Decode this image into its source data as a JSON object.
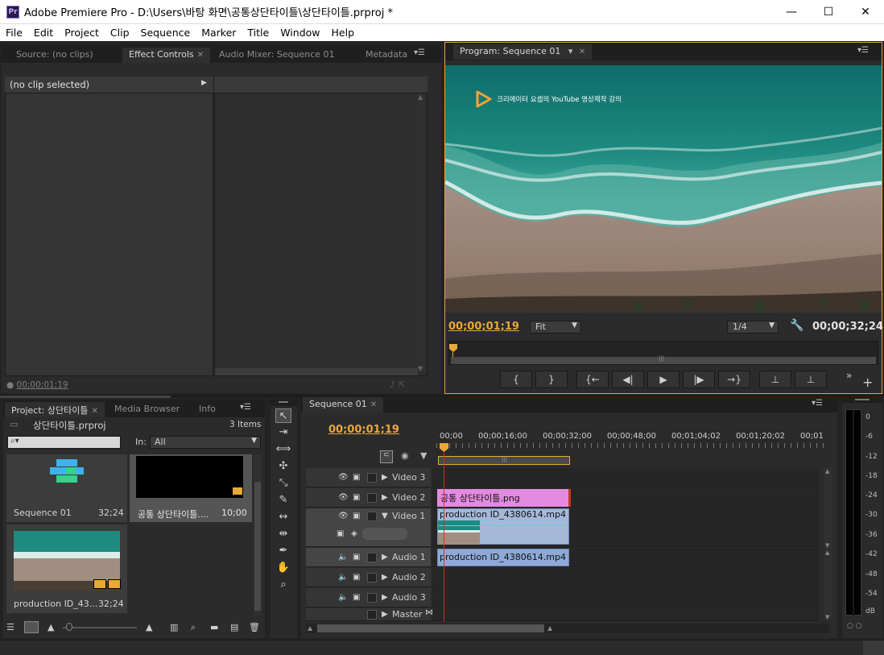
{
  "window": {
    "title": "Adobe Premiere Pro - D:\\Users\\바탕 화면\\공통상단타이틀\\상단타이틀.prproj *",
    "logo": "Pr",
    "minimize": "—",
    "maximize": "☐",
    "close": "✕"
  },
  "menu": [
    "File",
    "Edit",
    "Project",
    "Clip",
    "Sequence",
    "Marker",
    "Title",
    "Window",
    "Help"
  ],
  "source_panel": {
    "tabs": [
      "Source: (no clips)",
      "Effect Controls",
      "Audio Mixer: Sequence 01",
      "Metadata"
    ],
    "no_clip": "(no clip selected)",
    "timecode": "00;00;01;19"
  },
  "program_monitor": {
    "tab": "Program: Sequence 01",
    "overlay_text": "크리에이터 요셉의 YouTube 영상제작 강의",
    "current_time": "00;00;01;19",
    "zoom": "Fit",
    "resolution": "1/4",
    "duration": "00;00;32;24",
    "buttons": [
      "{",
      "}",
      "{←",
      "◀|",
      "▶",
      "|▶",
      "→}"
    ]
  },
  "project_panel": {
    "tabs": [
      "Project: 상단타이틀",
      "Media Browser",
      "Info"
    ],
    "project_file": "상단타이틀.prproj",
    "item_count": "3 Items",
    "in_label": "In:",
    "in_value": "All",
    "items": [
      {
        "name": "Sequence 01",
        "duration": "32;24"
      },
      {
        "name": "공통 상단타이틀....",
        "duration": "10;00"
      },
      {
        "name": "production ID_43...",
        "duration": "32;24"
      }
    ]
  },
  "timeline": {
    "tab": "Sequence 01",
    "timecode": "00;00;01;19",
    "ruler": [
      "00;00",
      "00;00;16;00",
      "00;00;32;00",
      "00;00;48;00",
      "00;01;04;02",
      "00;01;20;02",
      "00;01"
    ],
    "tracks": [
      {
        "name": "Video 3",
        "clip": ""
      },
      {
        "name": "Video 2",
        "clip": "공통 상단타이틀.png"
      },
      {
        "name": "Video 1",
        "clip": "production ID_4380614.mp4 [V]"
      },
      {
        "name": "Audio 1",
        "clip": "production ID_4380614.mp4 [A]"
      },
      {
        "name": "Audio 2",
        "clip": ""
      },
      {
        "name": "Audio 3",
        "clip": ""
      },
      {
        "name": "Master",
        "clip": ""
      }
    ]
  },
  "meter": {
    "labels": [
      "0",
      "-6",
      "-12",
      "-18",
      "-24",
      "-30",
      "-36",
      "-42",
      "-48",
      "-54",
      "dB"
    ]
  },
  "colors": {
    "accent": "#e8a93b",
    "clip_video2": "#e38be0",
    "clip_video1": "#a5b8d8",
    "clip_audio": "#8ea9d6",
    "playhead": "#d3311f"
  }
}
